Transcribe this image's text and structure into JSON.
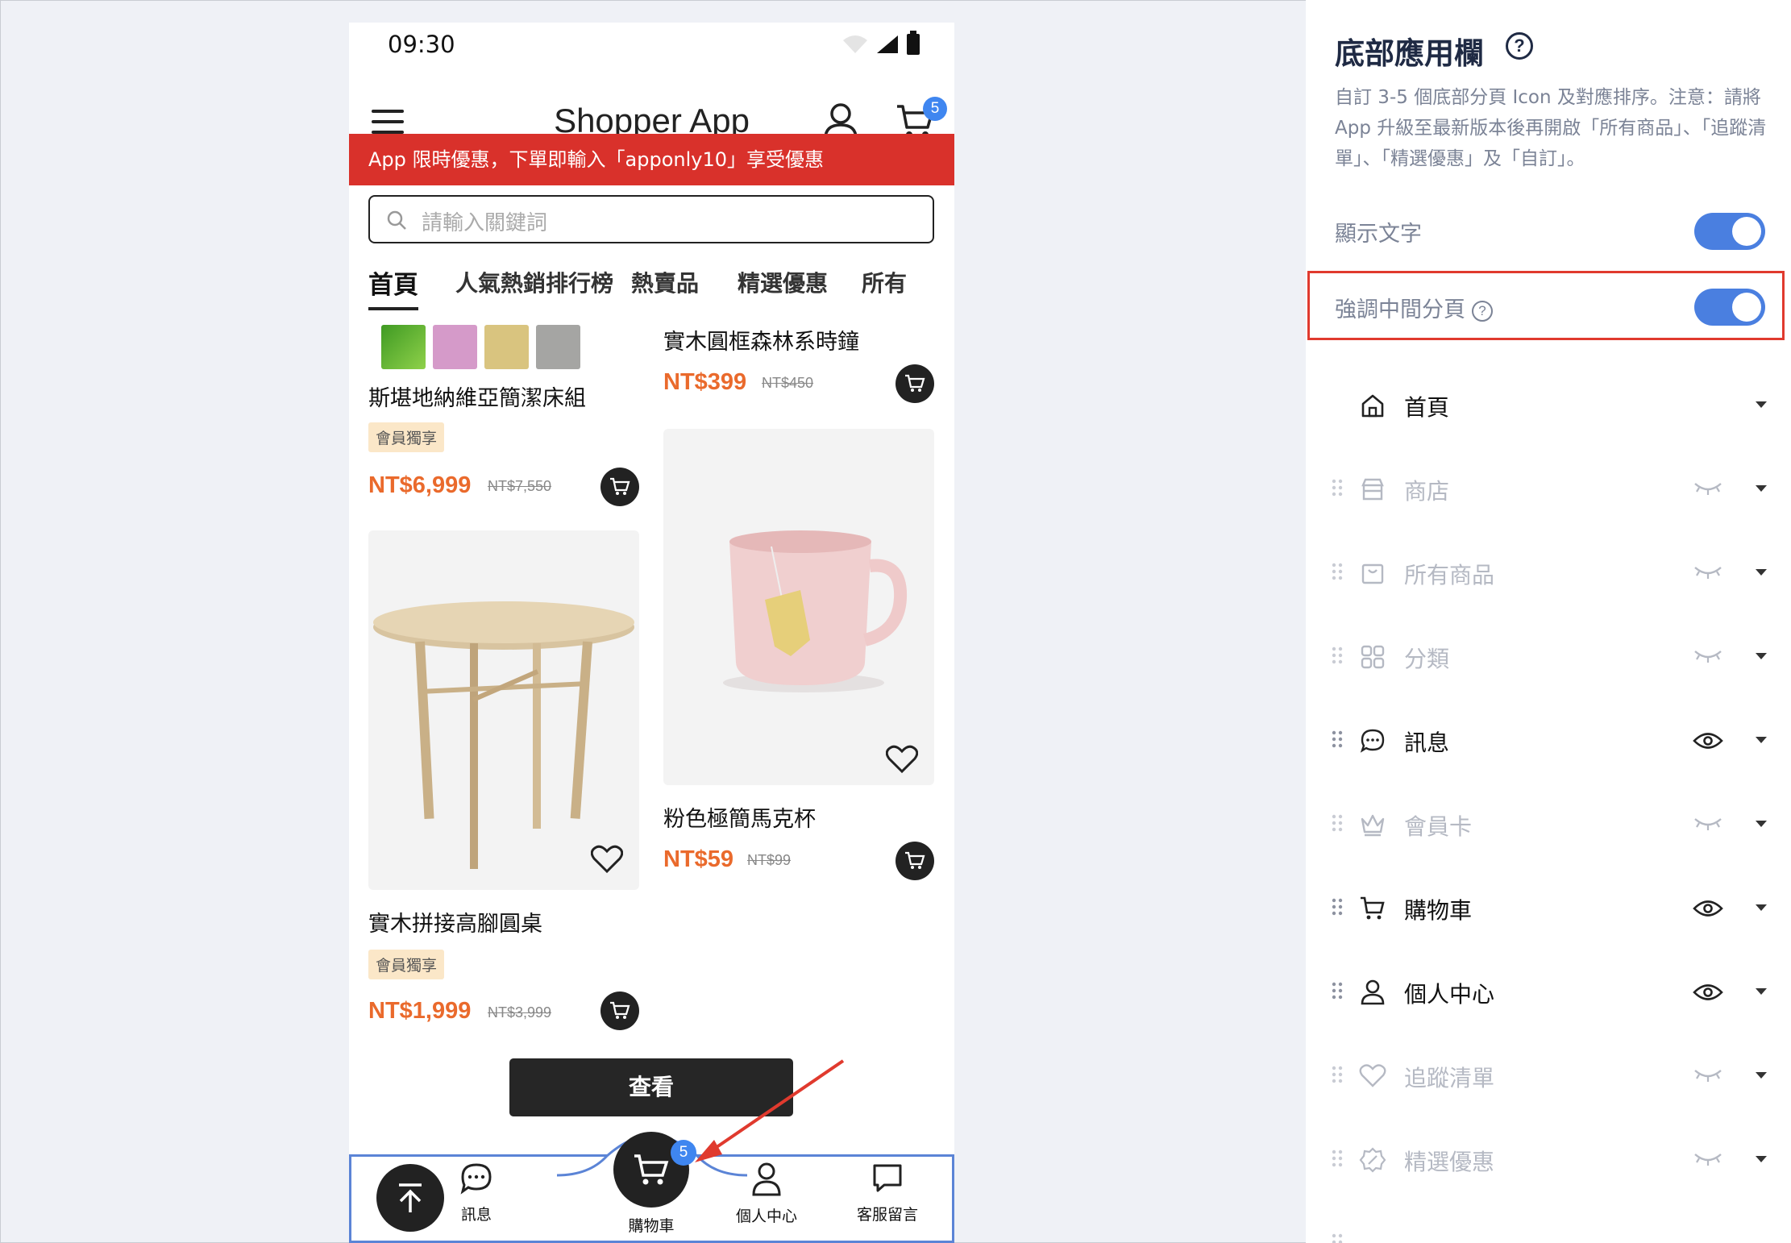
{
  "phone": {
    "status_time": "09:30",
    "app_title": "Shopper App",
    "cart_badge": "5",
    "promo_text": "App 限時優惠，下單即輸入「apponly10」享受優惠",
    "search_placeholder": "請輸入關鍵詞",
    "tabs": [
      "首頁",
      "人氣熱銷排行榜",
      "熱賣品",
      "精選優惠",
      "所有"
    ],
    "swatch_colors": [
      "#5fb236",
      "#d59ac9",
      "#d9c47f",
      "#a5a5a3"
    ],
    "products": [
      {
        "name": "斯堪地納維亞簡潔床組",
        "tag": "會員獨享",
        "price": "NT$6,999",
        "old_price": "NT$7,550"
      },
      {
        "name": "實木圓框森林系時鐘",
        "price": "NT$399",
        "old_price": "NT$450"
      },
      {
        "name": "粉色極簡馬克杯",
        "price": "NT$59",
        "old_price": "NT$99"
      },
      {
        "name": "實木拼接高腳圓桌",
        "tag": "會員獨享",
        "price": "NT$1,999",
        "old_price": "NT$3,999"
      }
    ],
    "view_button": "查看",
    "tabbar": {
      "messages": "訊息",
      "cart": "購物車",
      "cart_badge": "5",
      "profile": "個人中心",
      "support": "客服留言"
    }
  },
  "panel": {
    "title": "底部應用欄",
    "help": "?",
    "description": "自訂 3-5 個底部分頁 Icon 及對應排序。注意：請將 App 升級至最新版本後再開啟「所有商品」、「追蹤清單」、「精選優惠」及「自訂」。",
    "show_text_label": "顯示文字",
    "emphasize_label": "強調中間分頁",
    "items": [
      {
        "label": "首頁",
        "icon": "home-icon",
        "visible": true
      },
      {
        "label": "商店",
        "icon": "store-icon",
        "visible": false
      },
      {
        "label": "所有商品",
        "icon": "bag-icon",
        "visible": false
      },
      {
        "label": "分類",
        "icon": "category-icon",
        "visible": false
      },
      {
        "label": "訊息",
        "icon": "chat-icon",
        "visible": true
      },
      {
        "label": "會員卡",
        "icon": "crown-icon",
        "visible": false
      },
      {
        "label": "購物車",
        "icon": "cart-icon",
        "visible": true
      },
      {
        "label": "個人中心",
        "icon": "user-icon",
        "visible": true
      },
      {
        "label": "追蹤清單",
        "icon": "heart-icon",
        "visible": false
      },
      {
        "label": "精選優惠",
        "icon": "discount-icon",
        "visible": false
      }
    ]
  },
  "colors": {
    "accent": "#4a7fe0",
    "promo": "#d9312b",
    "price": "#ea6a2c",
    "highlight": "#e03a2e"
  }
}
